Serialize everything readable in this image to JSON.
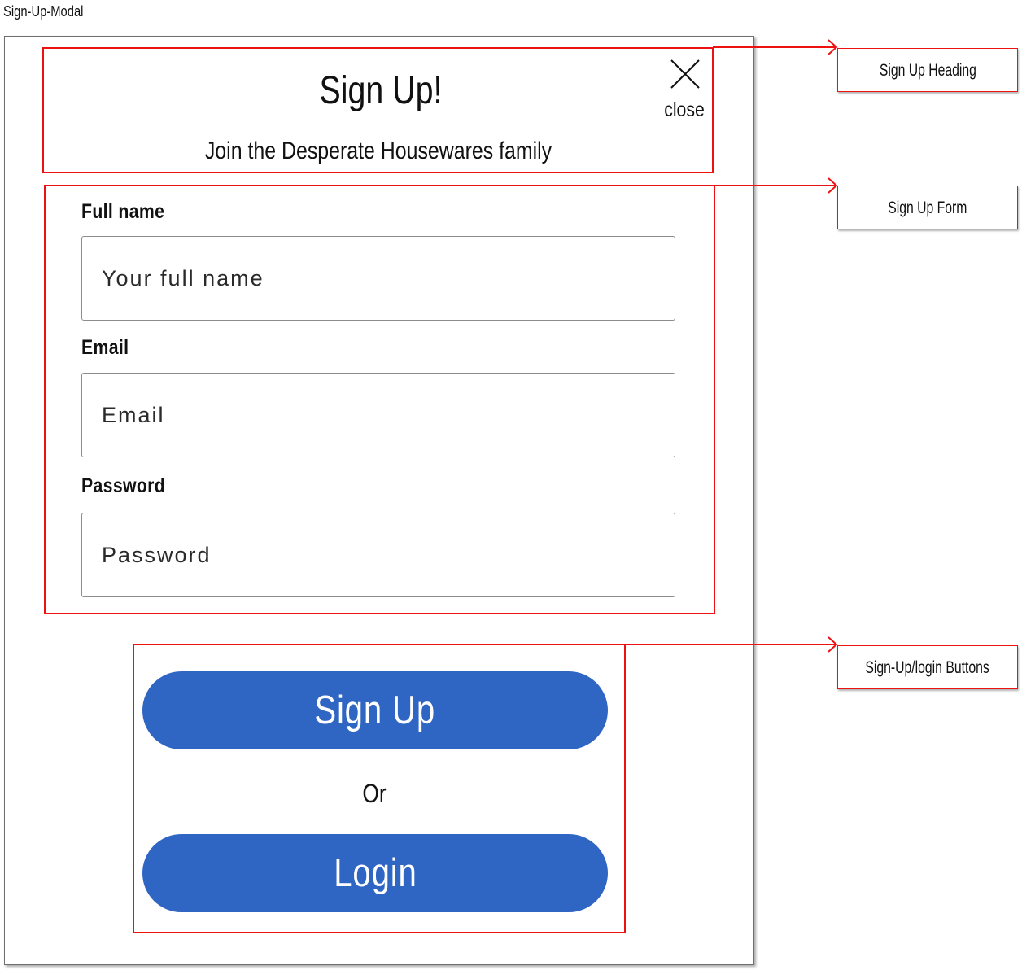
{
  "page": {
    "label": "Sign-Up-Modal"
  },
  "modal": {
    "title": "Sign Up!",
    "subtitle": "Join the Desperate Housewares family",
    "close_label": "close"
  },
  "form": {
    "full_name": {
      "label": "Full name",
      "placeholder": "Your full name",
      "value": ""
    },
    "email": {
      "label": "Email",
      "placeholder": "Email",
      "value": ""
    },
    "password": {
      "label": "Password",
      "placeholder": "Password",
      "value": ""
    }
  },
  "actions": {
    "signup_label": "Sign Up",
    "or_label": "Or",
    "login_label": "Login"
  },
  "annotations": {
    "heading": "Sign Up Heading",
    "form": "Sign Up Form",
    "buttons": "Sign-Up/login Buttons"
  },
  "colors": {
    "button": "#2f65c3",
    "annotation": "#e11111",
    "modal_border": "#6f6f6f"
  },
  "icons": {
    "close": "close-icon",
    "connector_arrow": "arrow-right-icon"
  }
}
